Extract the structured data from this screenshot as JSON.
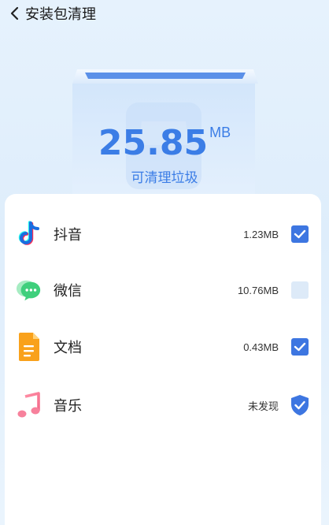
{
  "header": {
    "title": "安装包清理"
  },
  "summary": {
    "size_value": "25.85",
    "size_unit": "MB",
    "caption": "可清理垃圾"
  },
  "apps": [
    {
      "name": "抖音",
      "size": "1.23MB",
      "icon": "douyin-icon",
      "checked": true
    },
    {
      "name": "微信",
      "size": "10.76MB",
      "icon": "wechat-icon",
      "checked": false
    },
    {
      "name": "文档",
      "size": "0.43MB",
      "icon": "document-icon",
      "checked": true
    },
    {
      "name": "音乐",
      "status": "未发现",
      "icon": "music-icon",
      "protected": true
    }
  ],
  "colors": {
    "accent": "#3d76e1",
    "background": "#e6f2fd"
  }
}
